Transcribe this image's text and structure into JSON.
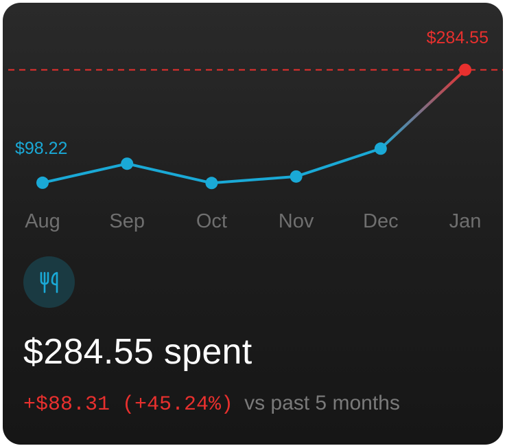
{
  "colors": {
    "line": "#1aa9d6",
    "highlight": "#e8302e",
    "axis_label": "#6f6f6f",
    "card_bg": "#1f1f1f",
    "icon_bg": "#1a3a42"
  },
  "chart_data": {
    "type": "line",
    "categories": [
      "Aug",
      "Sep",
      "Oct",
      "Nov",
      "Dec",
      "Jan"
    ],
    "values": [
      98.22,
      129.6,
      97.8,
      108.5,
      154.5,
      284.55
    ],
    "annotations": [
      {
        "category": "Aug",
        "label": "$98.22",
        "color": "#1aa9d6"
      },
      {
        "category": "Jan",
        "label": "$284.55",
        "color": "#e8302e"
      }
    ],
    "reference_line": {
      "value": 284.55,
      "style": "dashed",
      "color": "#e8302e"
    },
    "ylim": [
      55,
      300
    ],
    "grid": false,
    "title": "",
    "xlabel": "",
    "ylabel": ""
  },
  "category_icon": "fork-knife-icon",
  "summary": {
    "total": "$284.55 spent",
    "change": "+$88.31 (+45.24%)",
    "comparison": "vs past 5 months"
  }
}
